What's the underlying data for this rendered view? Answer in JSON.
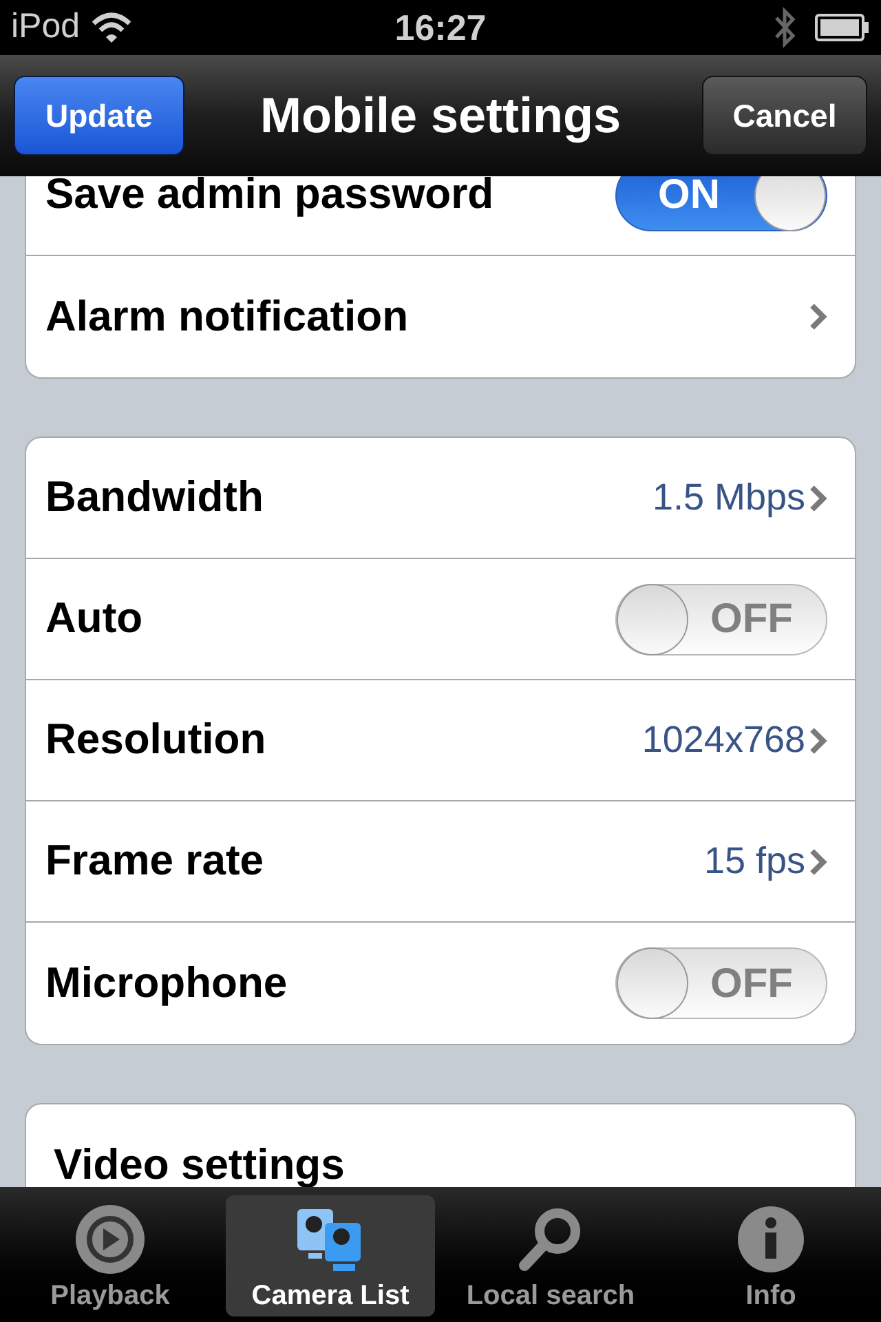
{
  "status_bar": {
    "carrier": "iPod",
    "time": "16:27"
  },
  "nav": {
    "title": "Mobile settings",
    "left_button": "Update",
    "right_button": "Cancel"
  },
  "groups": [
    {
      "rows": [
        {
          "kind": "toggle",
          "label": "Save admin password",
          "on": true,
          "switch_text": "ON"
        },
        {
          "kind": "link",
          "label": "Alarm notification"
        }
      ]
    },
    {
      "rows": [
        {
          "kind": "value",
          "label": "Bandwidth",
          "value": "1.5 Mbps"
        },
        {
          "kind": "toggle",
          "label": "Auto",
          "on": false,
          "switch_text": "OFF"
        },
        {
          "kind": "value",
          "label": "Resolution",
          "value": "1024x768"
        },
        {
          "kind": "value",
          "label": "Frame rate",
          "value": "15 fps"
        },
        {
          "kind": "toggle",
          "label": "Microphone",
          "on": false,
          "switch_text": "OFF"
        }
      ]
    },
    {
      "rows": [
        {
          "kind": "header",
          "label": "Video settings"
        }
      ]
    }
  ],
  "tabs": [
    {
      "label": "Playback",
      "kind": "playback",
      "selected": false
    },
    {
      "label": "Camera List",
      "kind": "cameras",
      "selected": true
    },
    {
      "label": "Local search",
      "kind": "search",
      "selected": false
    },
    {
      "label": "Info",
      "kind": "info",
      "selected": false
    }
  ]
}
